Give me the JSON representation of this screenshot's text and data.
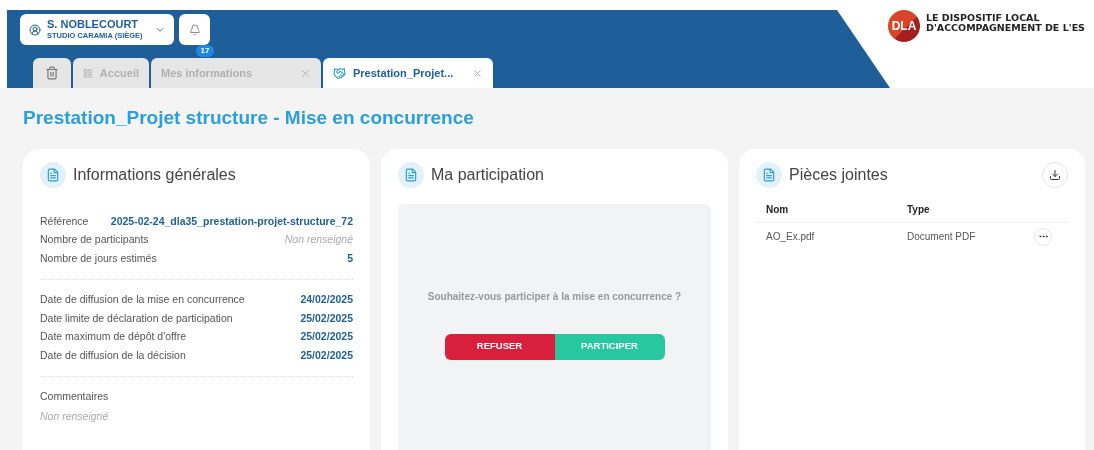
{
  "user": {
    "name": "S. NOBLECOURT",
    "org": "STUDIO CARAMIA (SIÈGE)"
  },
  "notifications": {
    "count": "17"
  },
  "tabs": [
    {
      "kind": "trash",
      "selected": false,
      "closable": false
    },
    {
      "kind": "home",
      "label": "Accueil",
      "selected": false,
      "closable": false
    },
    {
      "kind": "page",
      "label": "Mes informations",
      "selected": false,
      "closable": true
    },
    {
      "kind": "project",
      "label": "Prestation_Projet...",
      "selected": true,
      "closable": true
    }
  ],
  "logo": {
    "mark": "DLA",
    "line1": "LE DISPOSITIF LOCAL",
    "line2": "D'ACCOMPAGNEMENT DE L'ES"
  },
  "page_title": "Prestation_Projet structure - Mise en concurrence",
  "general": {
    "title": "Informations générales",
    "groups": [
      [
        {
          "label": "Référence",
          "value": "2025-02-24_dla35_prestation-projet-structure_72",
          "empty": false
        },
        {
          "label": "Nombre de participants",
          "value": "Non renseigné",
          "empty": true
        },
        {
          "label": "Nombre de jours estimés",
          "value": "5",
          "empty": false
        }
      ],
      [
        {
          "label": "Date de diffusion de la mise en concurrence",
          "value": "24/02/2025",
          "empty": false
        },
        {
          "label": "Date limite de déclaration de participation",
          "value": "25/02/2025",
          "empty": false
        },
        {
          "label": "Date maximum de dépôt d'offre",
          "value": "25/02/2025",
          "empty": false
        },
        {
          "label": "Date de diffusion de la décision",
          "value": "25/02/2025",
          "empty": false
        }
      ]
    ],
    "comments_label": "Commentaires",
    "comments_value": "Non renseigné"
  },
  "participation": {
    "title": "Ma participation",
    "question": "Souhaitez-vous participer à la mise en concurrence ?",
    "refuse": "REFUSER",
    "accept": "PARTICIPER"
  },
  "attachments": {
    "title": "Pièces jointes",
    "columns": [
      "Nom",
      "Type"
    ],
    "rows": [
      {
        "name": "AO_Ex.pdf",
        "type": "Document PDF"
      }
    ]
  }
}
